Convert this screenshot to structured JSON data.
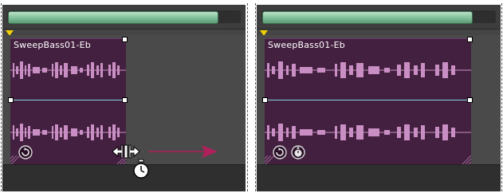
{
  "panels": {
    "before": {
      "clip_title": "SweepBass01-Eb"
    },
    "after": {
      "clip_title": "SweepBass01-Eb"
    }
  },
  "icons": {
    "loop": "loop-icon",
    "stretch": "stretch-icon",
    "resize_cursor": "resize-horizontal-cursor-icon",
    "stopwatch": "stopwatch-icon",
    "arrow": "arrow-right-icon"
  },
  "colors": {
    "clip_bg": "#43203f",
    "waveform": "#c98fc4",
    "center_line": "#7fd2d6",
    "scroll_thumb": "#8fcaa6",
    "marker": "#f0d000",
    "arrow": "#b0205a"
  }
}
